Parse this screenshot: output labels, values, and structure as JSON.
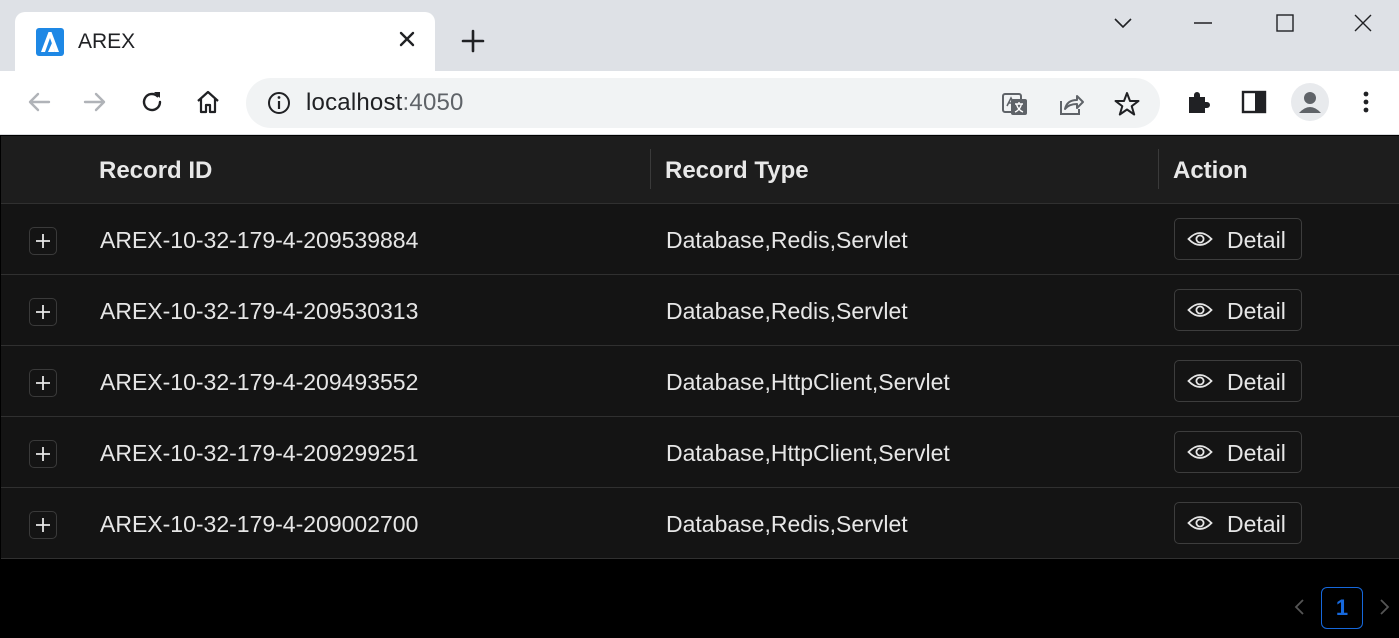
{
  "browser": {
    "tab_title": "AREX",
    "url_host": "localhost",
    "url_port": ":4050"
  },
  "table": {
    "columns": [
      "Record ID",
      "Record Type",
      "Action"
    ],
    "rows": [
      {
        "record_id": "AREX-10-32-179-4-209539884",
        "record_type": "Database,Redis,Servlet",
        "action": "Detail"
      },
      {
        "record_id": "AREX-10-32-179-4-209530313",
        "record_type": "Database,Redis,Servlet",
        "action": "Detail"
      },
      {
        "record_id": "AREX-10-32-179-4-209493552",
        "record_type": "Database,HttpClient,Servlet",
        "action": "Detail"
      },
      {
        "record_id": "AREX-10-32-179-4-209299251",
        "record_type": "Database,HttpClient,Servlet",
        "action": "Detail"
      },
      {
        "record_id": "AREX-10-32-179-4-209002700",
        "record_type": "Database,Redis,Servlet",
        "action": "Detail"
      }
    ]
  },
  "pagination": {
    "current_page": "1"
  },
  "colors": {
    "accent": "#1668dc",
    "favicon": "#1e88e5"
  }
}
